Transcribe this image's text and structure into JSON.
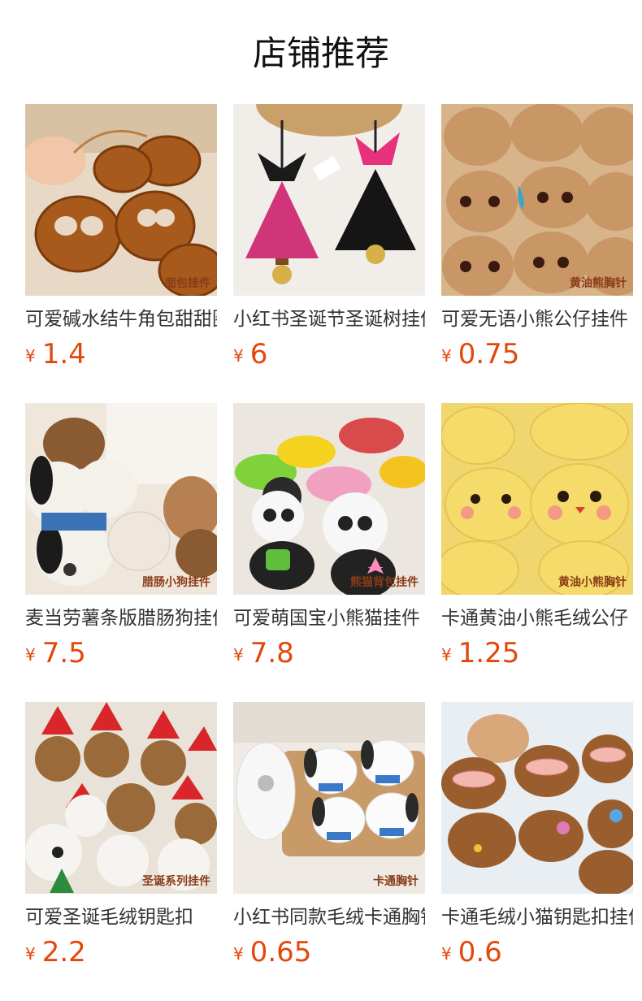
{
  "page_title": "店铺推荐",
  "currency_symbol": "¥",
  "products": [
    {
      "name": "可爱碱水结牛角包甜甜圈挂件",
      "price": "1.4",
      "image_text": "面包挂件"
    },
    {
      "name": "小红书圣诞节圣诞树挂件",
      "price": "6",
      "image_text": ""
    },
    {
      "name": "可爱无语小熊公仔挂件",
      "price": "0.75",
      "image_text": "黄油熊胸针"
    },
    {
      "name": "麦当劳薯条版腊肠狗挂件",
      "price": "7.5",
      "image_text": "腊肠小狗挂件"
    },
    {
      "name": "可爱萌国宝小熊猫挂件",
      "price": "7.8",
      "image_text": "熊猫背包挂件"
    },
    {
      "name": "卡通黄油小熊毛绒公仔",
      "price": "1.25",
      "image_text": "黄油小熊胸针"
    },
    {
      "name": "可爱圣诞毛绒钥匙扣",
      "price": "2.2",
      "image_text": "圣诞系列挂件"
    },
    {
      "name": "小红书同款毛绒卡通胸针",
      "price": "0.65",
      "image_text": "卡通胸针"
    },
    {
      "name": "卡通毛绒小猫钥匙扣挂件",
      "price": "0.6",
      "image_text": ""
    }
  ]
}
